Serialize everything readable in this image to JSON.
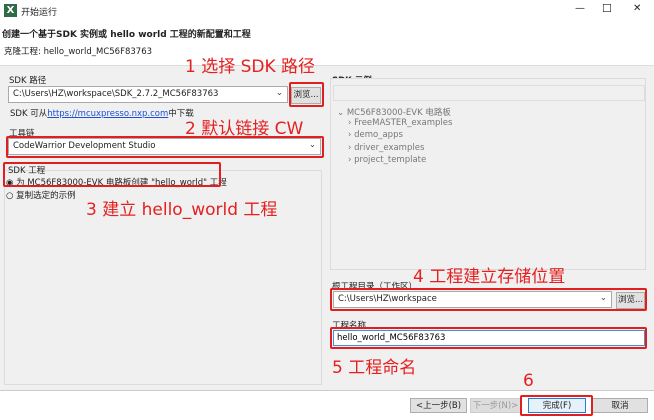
{
  "window": {
    "title": "开始运行",
    "controls": {
      "minimize": "—",
      "maximize": "☐",
      "close": "✕"
    }
  },
  "header": {
    "heading": "创建一个基于SDK 实例或 hello world 工程的新配置和工程",
    "clone_info": "克隆工程: hello_world_MC56F83763"
  },
  "sdk_path": {
    "label": "SDK 路径",
    "value": "C:\\Users\\HZ\\workspace\\SDK_2.7.2_MC56F83763",
    "browse": "浏览...",
    "download_prefix": "SDK 可从",
    "download_link": "https://mcuxpresso.nxp.com",
    "download_suffix": "中下载"
  },
  "toolchain": {
    "label": "工具链",
    "value": "CodeWarrior Development Studio"
  },
  "sdk_project": {
    "label": "SDK 工程",
    "options": [
      "为 MC56F83000-EVK 电路板创建 \"hello_world\" 工程",
      "复制选定的示例"
    ],
    "selected": 0
  },
  "sdk_examples": {
    "label": "SDK 示例",
    "search": "",
    "root": "MC56F83000-EVK 电路板",
    "children": [
      "FreeMASTER_examples",
      "demo_apps",
      "driver_examples",
      "project_template"
    ]
  },
  "root_dir": {
    "label": "根工程目录（工作区）",
    "value": "C:\\Users\\HZ\\workspace",
    "browse": "浏览..."
  },
  "project_name": {
    "label": "工程名称",
    "value": "hello_world_MC56F83763"
  },
  "buttons": {
    "back": "<上一步(B)",
    "next": "下一步(N)>",
    "finish": "完成(F)",
    "cancel": "取消"
  },
  "annotations": [
    "1 选择 SDK 路径",
    "2 默认链接 CW",
    "3 建立 hello_world 工程",
    "4 工程建立存储位置",
    "5 工程命名",
    "6"
  ],
  "colors": {
    "annotation": "#e52020",
    "link": "#1a4fd6"
  }
}
